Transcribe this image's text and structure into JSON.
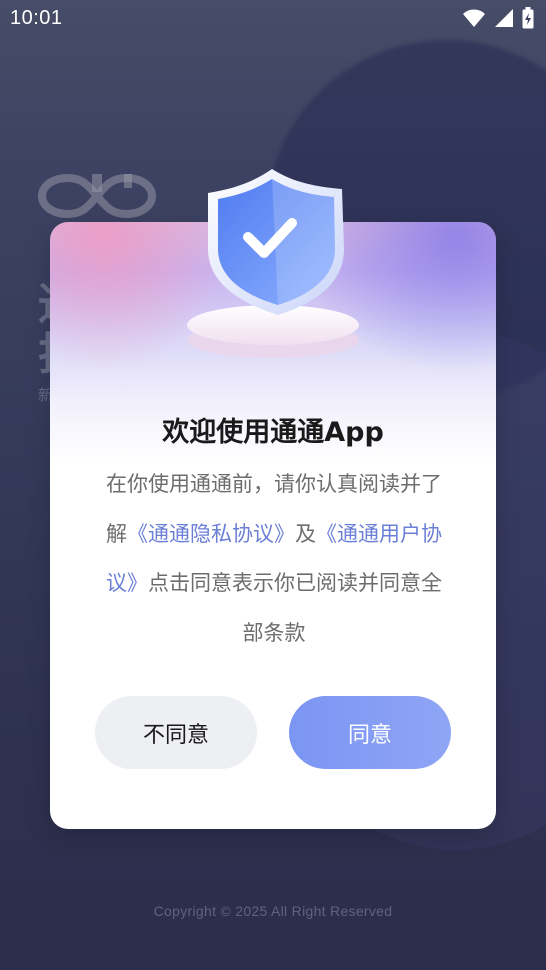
{
  "status_bar": {
    "time": "10:01",
    "icons": [
      "wifi-icon",
      "signal-icon",
      "battery-charging-icon"
    ]
  },
  "background": {
    "headline_fragments": [
      "通",
      "护"
    ],
    "small_text": "新",
    "copyright": "Copyright © 2025 All Right Reserved"
  },
  "dialog": {
    "title": "欢迎使用通通App",
    "body_prefix": "在你使用通通前，请你认真阅读并了解",
    "privacy_link": "《通通隐私协议》",
    "conjunction": "及",
    "user_link": "《通通用户协议》",
    "body_suffix": "点击同意表示你已阅读并同意全部条款",
    "disagree_label": "不同意",
    "agree_label": "同意"
  },
  "colors": {
    "accent": "#7B95F3",
    "link": "#6B7FD6",
    "background": "#353A5B"
  }
}
